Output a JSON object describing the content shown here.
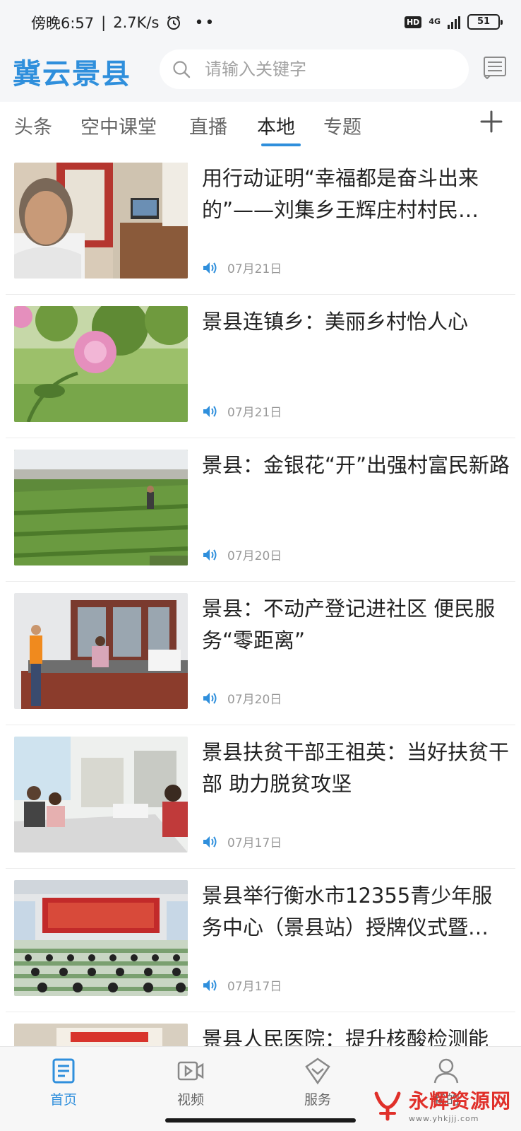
{
  "status_bar": {
    "time": "傍晚6:57",
    "net_speed": "2.7K/s",
    "network": "4G",
    "hd": "HD",
    "battery": "51"
  },
  "header": {
    "app_title": "冀云景县",
    "search_placeholder": "请输入关键字"
  },
  "tabs": [
    {
      "label": "头条",
      "active": false
    },
    {
      "label": "空中课堂",
      "active": false
    },
    {
      "label": "直播",
      "active": false
    },
    {
      "label": "本地",
      "active": true
    },
    {
      "label": "专题",
      "active": false
    }
  ],
  "news": [
    {
      "title": "用行动证明“幸福都是奋斗出来的”——刘集乡王辉庄村村民…",
      "date": "07月21日"
    },
    {
      "title": "景县连镇乡：美丽乡村怡人心",
      "date": "07月21日"
    },
    {
      "title": "景县：金银花“开”出强村富民新路",
      "date": "07月20日"
    },
    {
      "title": "景县：不动产登记进社区 便民服务“零距离”",
      "date": "07月20日"
    },
    {
      "title": "景县扶贫干部王祖英：当好扶贫干部 助力脱贫攻坚",
      "date": "07月17日"
    },
    {
      "title": "景县举行衡水市12355青少年服务中心（景县站）授牌仪式暨…",
      "date": "07月17日"
    },
    {
      "title": "景县人民医院：提升核酸检测能",
      "date": ""
    }
  ],
  "bottom_nav": [
    {
      "label": "首页",
      "icon": "home-news-icon",
      "active": true
    },
    {
      "label": "视频",
      "icon": "video-icon",
      "active": false
    },
    {
      "label": "服务",
      "icon": "service-icon",
      "active": false
    },
    {
      "label": "我的",
      "icon": "profile-icon",
      "active": false
    }
  ],
  "watermark": {
    "text": "永辉资源网",
    "url": "www.yhkjjj.com"
  },
  "colors": {
    "accent": "#2f8fdc",
    "watermark": "#e0302a"
  }
}
